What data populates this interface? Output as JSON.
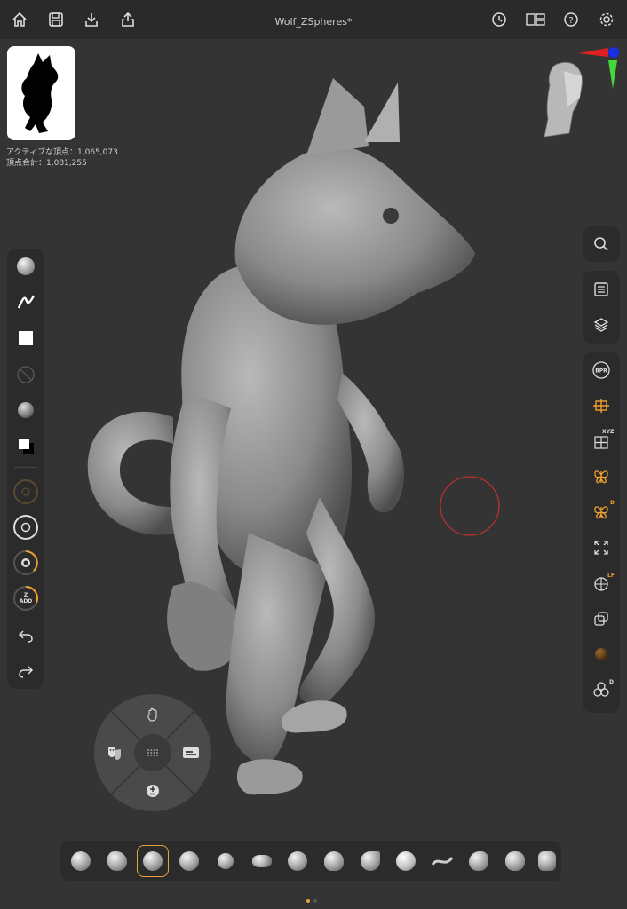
{
  "app": {
    "document_title": "Wolf_ZSpheres*"
  },
  "stats": {
    "active_points": "アクティブな頂点：1,065,073",
    "total_points": "頂点合計：1,081,255"
  },
  "toolbar_top": {
    "left": [
      "home-icon",
      "save-icon",
      "import-icon",
      "share-icon"
    ],
    "right": [
      "history-icon",
      "layout-icon",
      "help-icon",
      "settings-icon"
    ]
  },
  "left_panel": {
    "icons": [
      "brush-preview-icon",
      "stroke-icon",
      "alpha-icon",
      "texture-off-icon",
      "material-icon",
      "color-swatch-icon",
      "draw-size-dial",
      "focal-shift-dial",
      "intensity-dial",
      "zadd-dial",
      "undo-icon",
      "redo-icon"
    ],
    "zadd_label": "Z\nADD",
    "zadd_line1": "Z",
    "zadd_line2": "ADD"
  },
  "right_panel": {
    "icons": [
      "search-icon",
      "menu-list-icon",
      "layers-icon",
      "bpr-icon",
      "floor-grid-icon",
      "xyz-grid-icon",
      "symmetry-icon",
      "symmetry-d-icon",
      "fit-icon",
      "polyframe-icon",
      "transparency-icon",
      "material-sphere-icon",
      "spheres-icon"
    ],
    "bpr_label": "BPR",
    "xyz_label": "XYZ",
    "d_label": "D",
    "lf_label": "LF",
    "d2_label": "D"
  },
  "gesture_wheel": {
    "items": [
      "move-hand-icon",
      "smooth-mask-icon",
      "theater-icon",
      "plus-minus-icon",
      "grid-dots-icon"
    ]
  },
  "brush_bar": {
    "count": 14,
    "selected_index": 2
  },
  "page_indicator": {
    "pages": 2,
    "active": 0
  },
  "colors": {
    "accent": "#e8a040",
    "background": "#343434",
    "panel": "#2b2b2b"
  }
}
